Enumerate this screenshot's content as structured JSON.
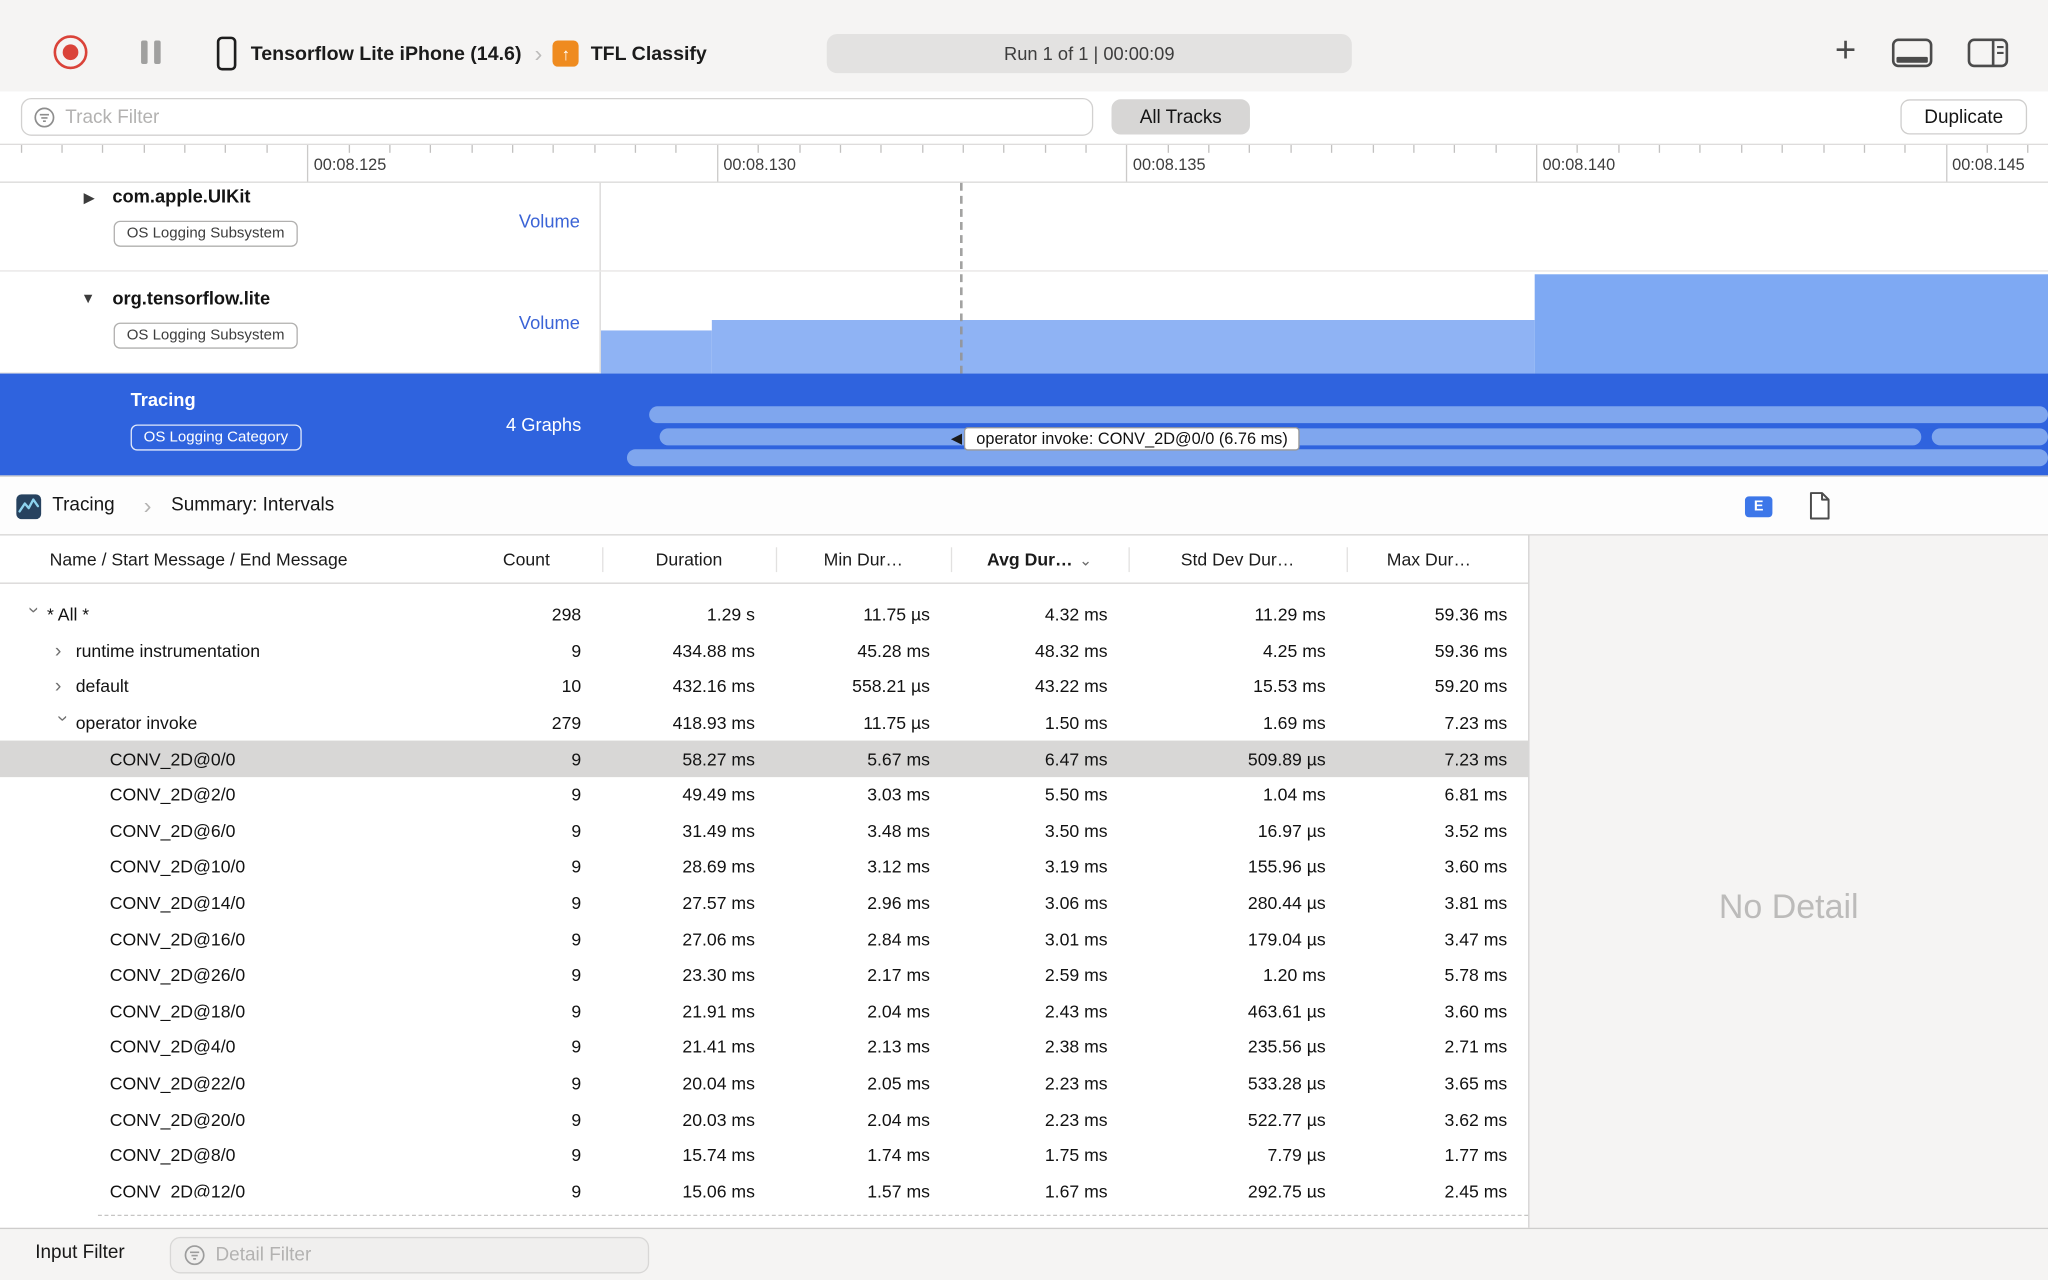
{
  "toolbar": {
    "device_name": "Tensorflow Lite iPhone (14.6)",
    "app_name": "TFL Classify",
    "run_status": "Run 1 of 1  |  00:00:09"
  },
  "glyphs": {
    "plus": "+",
    "toolbar_chevron": "›",
    "breadcrumb_chevron": "›",
    "app_arrow": "↑",
    "triangle_right": "▶",
    "triangle_down": "▼",
    "tooltip_arrow": "◀",
    "sort_chevron": "⌄",
    "disclosure": "›"
  },
  "filter_bar": {
    "track_filter_placeholder": "Track Filter",
    "all_tracks": "All Tracks",
    "duplicate": "Duplicate"
  },
  "ruler": {
    "labels": [
      "00:08.125",
      "00:08.130",
      "00:08.135",
      "00:08.140",
      "00:08.145"
    ]
  },
  "tracks": {
    "uikit": {
      "name": "com.apple.UIKit",
      "badge": "OS Logging Subsystem",
      "meta": "Volume"
    },
    "tensorflow": {
      "name": "org.tensorflow.lite",
      "badge": "OS Logging Subsystem",
      "meta": "Volume"
    },
    "tracing": {
      "name": "Tracing",
      "badge": "OS Logging Category",
      "meta": "4 Graphs"
    }
  },
  "tooltip": {
    "text": "operator invoke: CONV_2D@0/0 (6.76 ms)"
  },
  "detail_pane": {
    "breadcrumb": {
      "root": "Tracing",
      "page": "Summary: Intervals"
    },
    "e_badge": "E",
    "no_detail": "No Detail",
    "table": {
      "columns": [
        "Name / Start Message / End Message",
        "Count",
        "Duration",
        "Min Dur…",
        "Avg Dur…",
        "Std Dev Dur…",
        "Max Dur…"
      ],
      "sort_column": "Avg Dur…",
      "rows": [
        {
          "level": 0,
          "disclosure": "expanded",
          "name": "* All *",
          "count": "298",
          "duration": "1.29 s",
          "min": "11.75 µs",
          "avg": "4.32 ms",
          "std": "11.29 ms",
          "max": "59.36 ms",
          "selected": false
        },
        {
          "level": 1,
          "disclosure": "collapsed",
          "name": "runtime instrumentation",
          "count": "9",
          "duration": "434.88 ms",
          "min": "45.28 ms",
          "avg": "48.32 ms",
          "std": "4.25 ms",
          "max": "59.36 ms",
          "selected": false
        },
        {
          "level": 1,
          "disclosure": "collapsed",
          "name": "default",
          "count": "10",
          "duration": "432.16 ms",
          "min": "558.21 µs",
          "avg": "43.22 ms",
          "std": "15.53 ms",
          "max": "59.20 ms",
          "selected": false
        },
        {
          "level": 1,
          "disclosure": "expanded",
          "name": "operator invoke",
          "count": "279",
          "duration": "418.93 ms",
          "min": "11.75 µs",
          "avg": "1.50 ms",
          "std": "1.69 ms",
          "max": "7.23 ms",
          "selected": false
        },
        {
          "level": 2,
          "disclosure": "none",
          "name": "CONV_2D@0/0",
          "count": "9",
          "duration": "58.27 ms",
          "min": "5.67 ms",
          "avg": "6.47 ms",
          "std": "509.89 µs",
          "max": "7.23 ms",
          "selected": true
        },
        {
          "level": 2,
          "disclosure": "none",
          "name": "CONV_2D@2/0",
          "count": "9",
          "duration": "49.49 ms",
          "min": "3.03 ms",
          "avg": "5.50 ms",
          "std": "1.04 ms",
          "max": "6.81 ms",
          "selected": false
        },
        {
          "level": 2,
          "disclosure": "none",
          "name": "CONV_2D@6/0",
          "count": "9",
          "duration": "31.49 ms",
          "min": "3.48 ms",
          "avg": "3.50 ms",
          "std": "16.97 µs",
          "max": "3.52 ms",
          "selected": false
        },
        {
          "level": 2,
          "disclosure": "none",
          "name": "CONV_2D@10/0",
          "count": "9",
          "duration": "28.69 ms",
          "min": "3.12 ms",
          "avg": "3.19 ms",
          "std": "155.96 µs",
          "max": "3.60 ms",
          "selected": false
        },
        {
          "level": 2,
          "disclosure": "none",
          "name": "CONV_2D@14/0",
          "count": "9",
          "duration": "27.57 ms",
          "min": "2.96 ms",
          "avg": "3.06 ms",
          "std": "280.44 µs",
          "max": "3.81 ms",
          "selected": false
        },
        {
          "level": 2,
          "disclosure": "none",
          "name": "CONV_2D@16/0",
          "count": "9",
          "duration": "27.06 ms",
          "min": "2.84 ms",
          "avg": "3.01 ms",
          "std": "179.04 µs",
          "max": "3.47 ms",
          "selected": false
        },
        {
          "level": 2,
          "disclosure": "none",
          "name": "CONV_2D@26/0",
          "count": "9",
          "duration": "23.30 ms",
          "min": "2.17 ms",
          "avg": "2.59 ms",
          "std": "1.20 ms",
          "max": "5.78 ms",
          "selected": false
        },
        {
          "level": 2,
          "disclosure": "none",
          "name": "CONV_2D@18/0",
          "count": "9",
          "duration": "21.91 ms",
          "min": "2.04 ms",
          "avg": "2.43 ms",
          "std": "463.61 µs",
          "max": "3.60 ms",
          "selected": false
        },
        {
          "level": 2,
          "disclosure": "none",
          "name": "CONV_2D@4/0",
          "count": "9",
          "duration": "21.41 ms",
          "min": "2.13 ms",
          "avg": "2.38 ms",
          "std": "235.56 µs",
          "max": "2.71 ms",
          "selected": false
        },
        {
          "level": 2,
          "disclosure": "none",
          "name": "CONV_2D@22/0",
          "count": "9",
          "duration": "20.04 ms",
          "min": "2.05 ms",
          "avg": "2.23 ms",
          "std": "533.28 µs",
          "max": "3.65 ms",
          "selected": false
        },
        {
          "level": 2,
          "disclosure": "none",
          "name": "CONV_2D@20/0",
          "count": "9",
          "duration": "20.03 ms",
          "min": "2.04 ms",
          "avg": "2.23 ms",
          "std": "522.77 µs",
          "max": "3.62 ms",
          "selected": false
        },
        {
          "level": 2,
          "disclosure": "none",
          "name": "CONV_2D@8/0",
          "count": "9",
          "duration": "15.74 ms",
          "min": "1.74 ms",
          "avg": "1.75 ms",
          "std": "7.79 µs",
          "max": "1.77 ms",
          "selected": false
        },
        {
          "level": 2,
          "disclosure": "none",
          "name": "CONV_2D@12/0",
          "count": "9",
          "duration": "15.06 ms",
          "min": "1.57 ms",
          "avg": "1.67 ms",
          "std": "292.75 µs",
          "max": "2.45 ms",
          "selected": false
        }
      ]
    }
  },
  "bottom_bar": {
    "input_filter_label": "Input Filter",
    "detail_filter_placeholder": "Detail Filter"
  },
  "colors": {
    "selection_blue": "#2f63de",
    "interval_bar_blue": "#7fa6ee",
    "volume_area_blue": "#8fb3f4",
    "volume_area_blue_dark": "#7ea9f3",
    "volume_label_blue": "#3a63d6",
    "record_red": "#da4339",
    "selected_row_gray": "#d8d7d6"
  }
}
